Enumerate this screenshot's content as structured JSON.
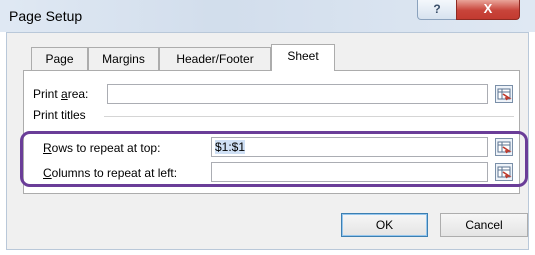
{
  "window": {
    "title": "Page Setup",
    "help_glyph": "?",
    "close_glyph": "X"
  },
  "tabs": [
    {
      "label": "Page",
      "active": false
    },
    {
      "label": "Margins",
      "active": false
    },
    {
      "label": "Header/Footer",
      "active": false
    },
    {
      "label": "Sheet",
      "active": true
    }
  ],
  "sheet": {
    "print_area": {
      "label_pre": "Print ",
      "label_accel": "a",
      "label_post": "rea:",
      "value": ""
    },
    "print_titles_label": "Print titles",
    "rows_to_repeat": {
      "label_accel": "R",
      "label_post": "ows to repeat at top:",
      "value": "$1:$1"
    },
    "columns_to_repeat": {
      "label_accel": "C",
      "label_post": "olumns to repeat at left:",
      "value": ""
    }
  },
  "buttons": {
    "ok": "OK",
    "cancel": "Cancel"
  },
  "colors": {
    "highlight_ring": "#6a3d98",
    "close_button": "#c8443a"
  }
}
